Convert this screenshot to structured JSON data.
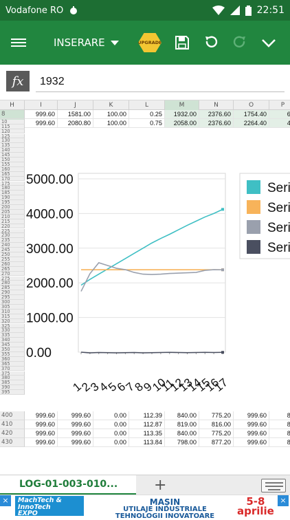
{
  "status": {
    "carrier": "Vodafone RO",
    "time": "22:51"
  },
  "toolbar": {
    "mode_label": "INSERARE",
    "upgrade_label": "UPGRADE"
  },
  "formula": {
    "fx_label": "fx",
    "value": "1932"
  },
  "columns": [
    "H",
    "I",
    "J",
    "K",
    "L",
    "M",
    "N",
    "O",
    "P"
  ],
  "top_rows": [
    {
      "row": "8",
      "cells": [
        "0.00",
        "999.60",
        "1581.00",
        "100.00",
        "0.25",
        "1932.00",
        "2376.60",
        "1754.40",
        "65"
      ]
    },
    {
      "row": "9",
      "cells": [
        "0.00",
        "999.60",
        "2080.80",
        "100.00",
        "0.75",
        "2058.00",
        "2376.60",
        "2264.40",
        "42"
      ]
    }
  ],
  "row_headers": [
    "10",
    "115",
    "120",
    "125",
    "130",
    "135",
    "140",
    "145",
    "150",
    "155",
    "160",
    "165",
    "170",
    "175",
    "180",
    "185",
    "190",
    "195",
    "200",
    "205",
    "210",
    "215",
    "220",
    "225",
    "230",
    "235",
    "240",
    "245",
    "250",
    "255",
    "260",
    "265",
    "270",
    "275",
    "280",
    "285",
    "290",
    "295",
    "300",
    "305",
    "310",
    "315",
    "320",
    "325",
    "330",
    "335",
    "340",
    "345",
    "350",
    "355",
    "360",
    "365",
    "370",
    "375",
    "380",
    "385",
    "390",
    "395"
  ],
  "bottom_rows": [
    {
      "row": "400",
      "cells": [
        "0.00",
        "999.60",
        "999.60",
        "0.00",
        "112.39",
        "840.00",
        "775.20",
        "999.60",
        "80"
      ]
    },
    {
      "row": "410",
      "cells": [
        "0.00",
        "999.60",
        "999.60",
        "0.00",
        "112.87",
        "819.00",
        "816.00",
        "999.60",
        "80"
      ]
    },
    {
      "row": "420",
      "cells": [
        "0.00",
        "999.60",
        "999.60",
        "0.00",
        "113.35",
        "840.00",
        "775.20",
        "999.60",
        "80"
      ]
    },
    {
      "row": "430",
      "cells": [
        "0.00",
        "999.60",
        "999.60",
        "0.00",
        "113.84",
        "798.00",
        "877.20",
        "999.60",
        "80"
      ]
    }
  ],
  "chart_data": {
    "type": "line",
    "title": "",
    "xlabel": "",
    "ylabel": "",
    "ylim": [
      0,
      5000
    ],
    "y_ticks": [
      "5000.00",
      "4000.00",
      "3000.00",
      "2000.00",
      "1000.00",
      "0.00"
    ],
    "x_ticks": [
      "1",
      "2",
      "3",
      "4",
      "5",
      "6",
      "7",
      "8",
      "9",
      "10",
      "11",
      "12",
      "13",
      "14",
      "15",
      "16",
      "17"
    ],
    "legend_position": "right",
    "legend_labels": [
      "Seri",
      "Seri",
      "Seri",
      "Seri"
    ],
    "series": [
      {
        "color": "#3fbfc4",
        "values": [
          1932,
          2100,
          2250,
          2400,
          2550,
          2700,
          2850,
          3000,
          3150,
          3280,
          3400,
          3530,
          3660,
          3780,
          3900,
          4000,
          4120
        ]
      },
      {
        "color": "#f7b35a",
        "values": [
          2376.6,
          2376.6,
          2376.6,
          2376.6,
          2376.6,
          2376.6,
          2376.6,
          2376.6,
          2376.6,
          2376.6,
          2376.6,
          2376.6,
          2376.6,
          2376.6,
          2376.6,
          2376.6,
          2376.6
        ]
      },
      {
        "color": "#9aa0ad",
        "values": [
          1754.4,
          2264.4,
          2580,
          2500,
          2420,
          2380,
          2300,
          2250,
          2240,
          2250,
          2270,
          2280,
          2290,
          2300,
          2360,
          2380,
          2376
        ]
      },
      {
        "color": "#4a4f60",
        "values": [
          0,
          -20,
          -10,
          -15,
          -20,
          -15,
          -10,
          -20,
          -15,
          -10,
          -5,
          -10,
          -15,
          -10,
          -5,
          -10,
          -5
        ]
      }
    ]
  },
  "sheet_tab": {
    "name": "LOG-01-003-010...",
    "add_label": "+"
  },
  "ad": {
    "logo_line1": "MachTech &",
    "logo_line2": "InnoTech",
    "logo_line3": "EXPO",
    "line1": "MAȘIN",
    "line2": "UTILAJE INDUSTRIALE",
    "line3": "TEHNOLOGII INOVATOARE",
    "date1": "5-8",
    "date2": "aprilie",
    "close": "×"
  },
  "colors": {
    "statusbar": "#1d6e33",
    "toolbar": "#21863f",
    "accent": "#21863f"
  }
}
